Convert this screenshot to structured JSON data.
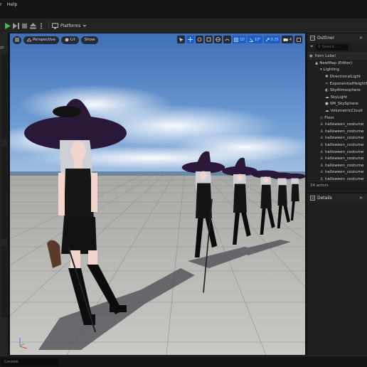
{
  "menu": [
    "r",
    "Help"
  ],
  "toolbar": {
    "platforms_label": "Platforms"
  },
  "left_panel": {
    "tag": "gs"
  },
  "viewport": {
    "view_mode": "Perspective",
    "lighting": "Lit",
    "show": "Show",
    "grid_snap": "10",
    "angle_snap": "10°",
    "scale_snap": "0.25",
    "camera_speed": "4"
  },
  "outliner": {
    "title": "Outliner",
    "search_placeholder": "Search...",
    "column_label": "Item Label",
    "rows": [
      {
        "label": "NewMap (Editor)",
        "indent": 1,
        "icon": "map"
      },
      {
        "label": "Lighting",
        "indent": 2,
        "icon": "folder"
      },
      {
        "label": "DirectionalLight",
        "indent": 3,
        "icon": "sun"
      },
      {
        "label": "ExponentialHeightFog",
        "indent": 3,
        "icon": "fog"
      },
      {
        "label": "SkyAtmosphere",
        "indent": 3,
        "icon": "sky"
      },
      {
        "label": "SkyLight",
        "indent": 3,
        "icon": "skylight"
      },
      {
        "label": "SM_SkySphere",
        "indent": 3,
        "icon": "sphere"
      },
      {
        "label": "VolumetricCloud",
        "indent": 3,
        "icon": "cloud"
      },
      {
        "label": "Floor",
        "indent": 2,
        "icon": "mesh"
      },
      {
        "label": "halloween_costume",
        "indent": 2,
        "icon": "person"
      },
      {
        "label": "halloween_costume",
        "indent": 2,
        "icon": "person"
      },
      {
        "label": "halloween_costume",
        "indent": 2,
        "icon": "person"
      },
      {
        "label": "halloween_costume",
        "indent": 2,
        "icon": "person"
      },
      {
        "label": "halloween_costume",
        "indent": 2,
        "icon": "person"
      },
      {
        "label": "halloween_costume",
        "indent": 2,
        "icon": "person"
      },
      {
        "label": "halloween_costume",
        "indent": 2,
        "icon": "person"
      },
      {
        "label": "halloween_costume",
        "indent": 2,
        "icon": "person"
      },
      {
        "label": "halloween_costume",
        "indent": 2,
        "icon": "person"
      }
    ],
    "actor_count": "24 actors"
  },
  "details": {
    "title": "Details"
  },
  "status": {
    "console_placeholder": "Console"
  },
  "colors": {
    "accent": "#1e5ec9",
    "play": "#3fbf3f"
  }
}
